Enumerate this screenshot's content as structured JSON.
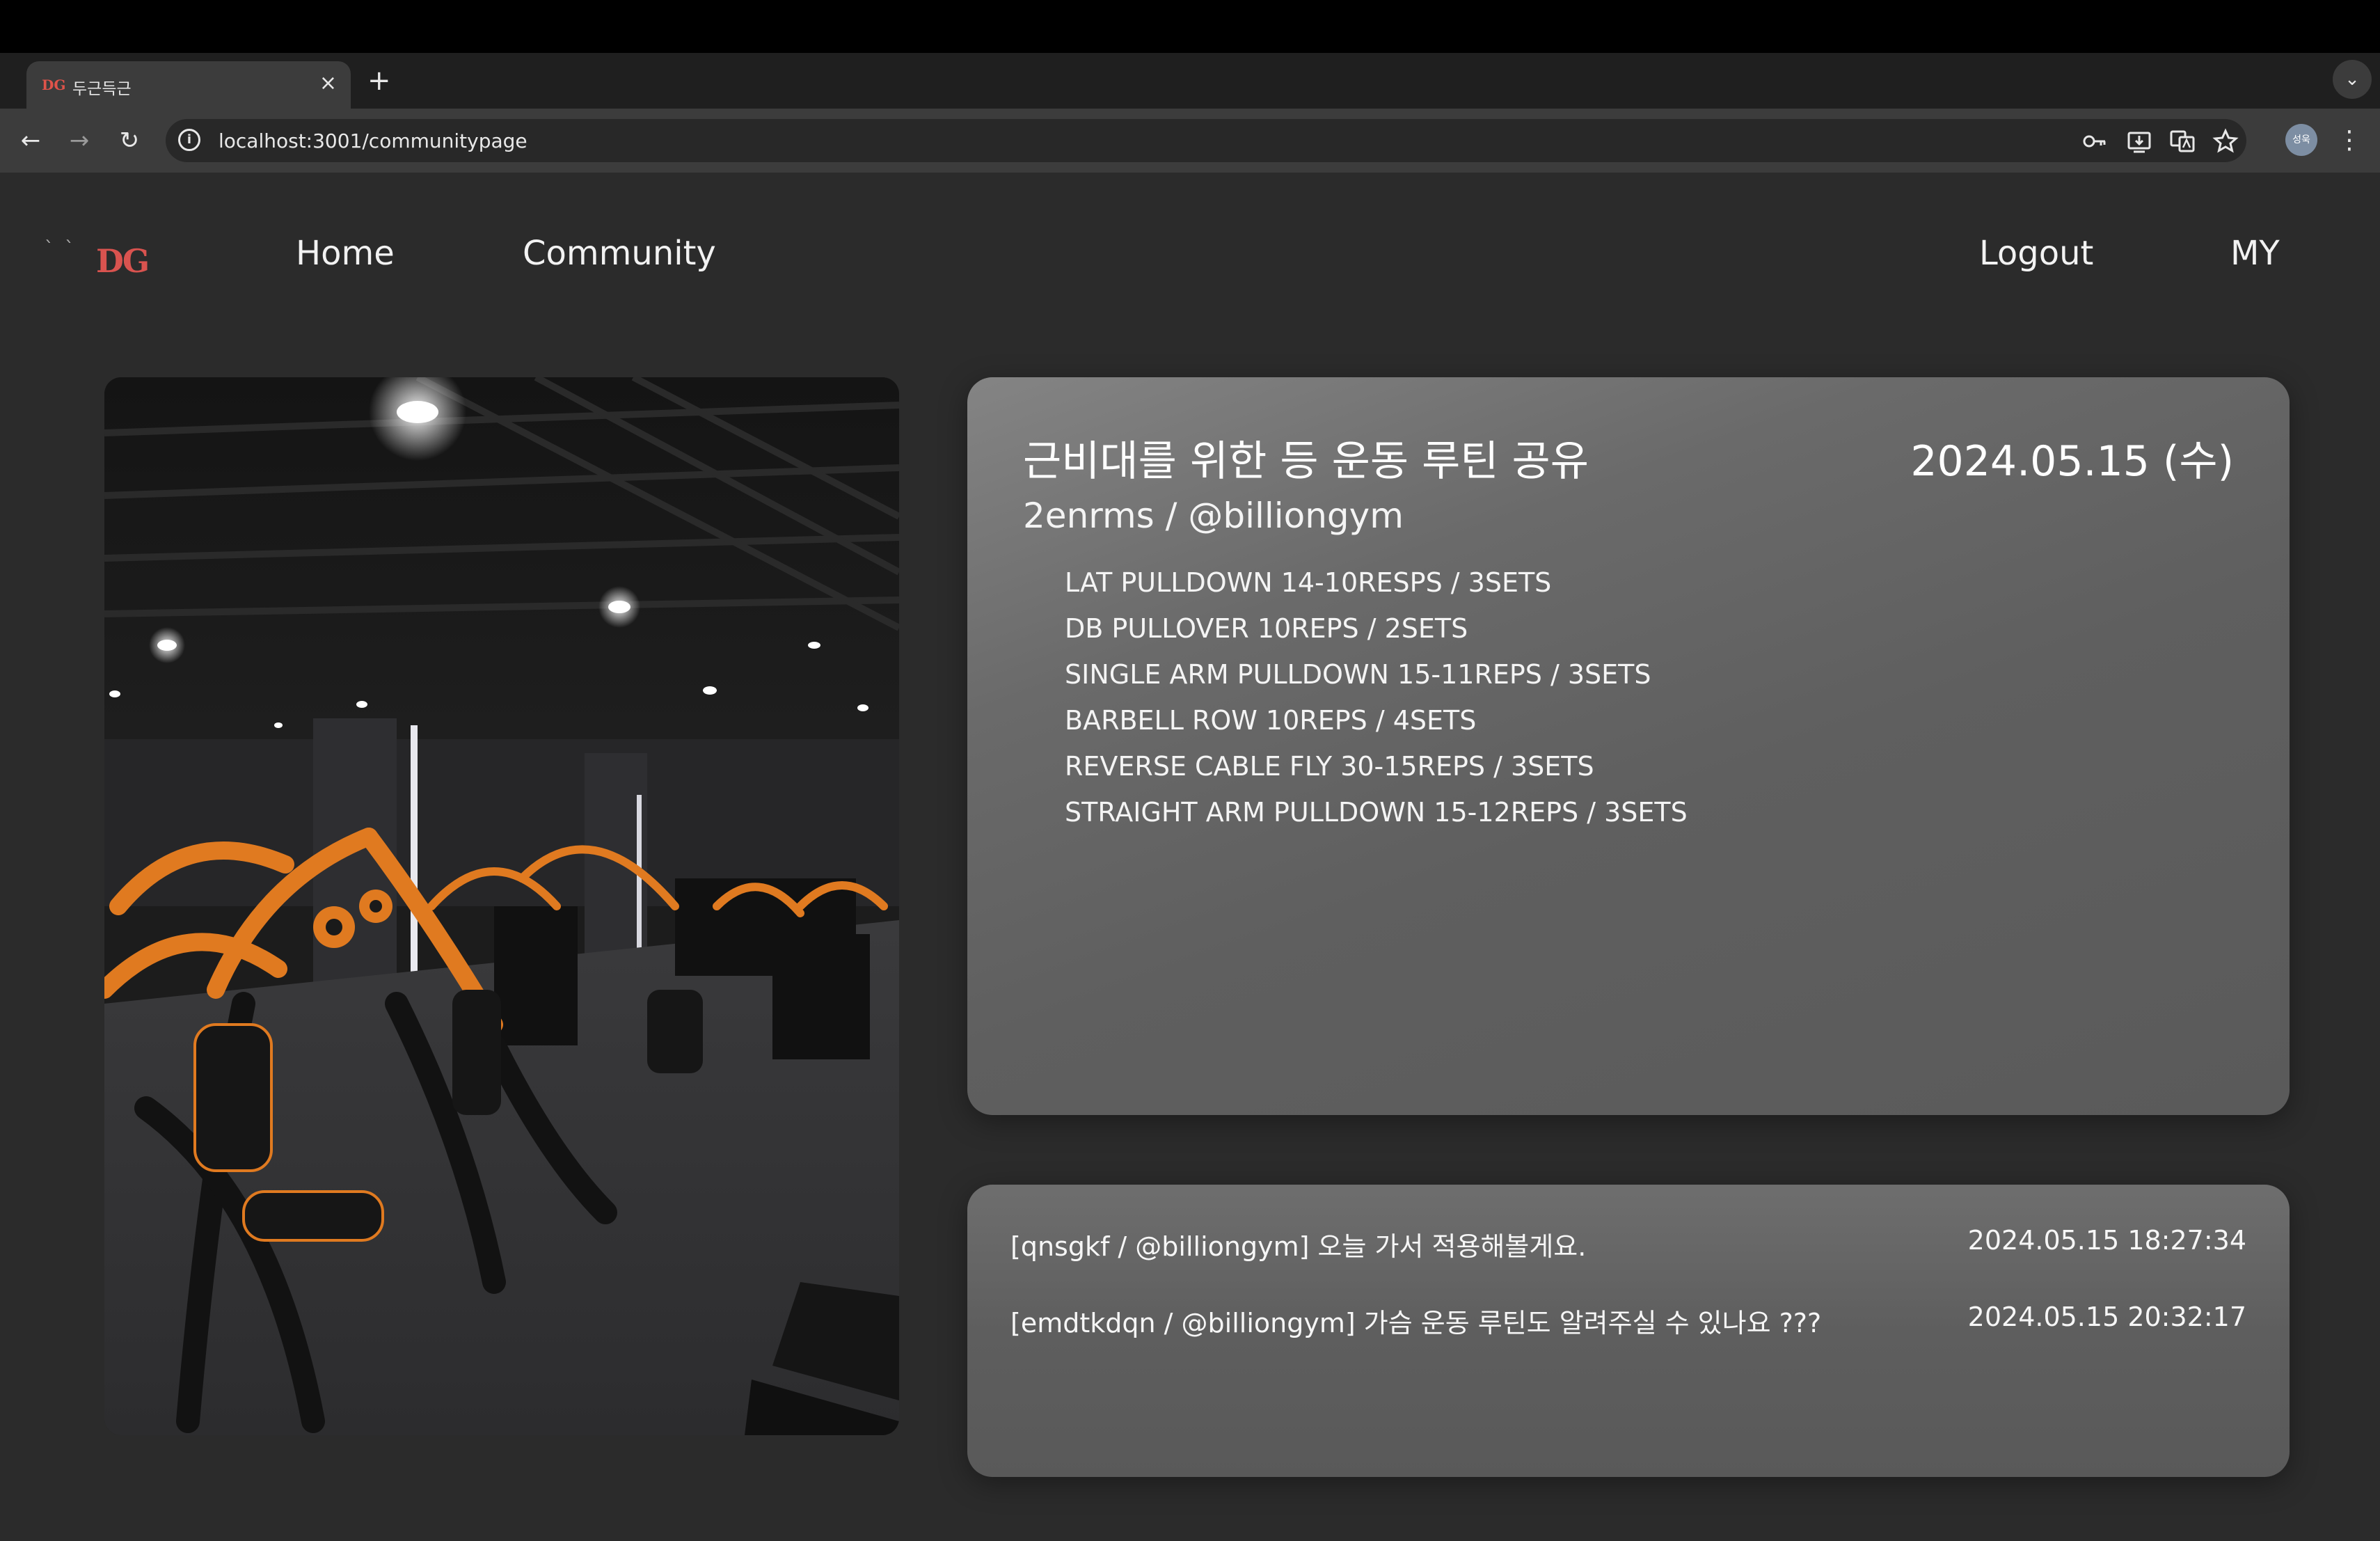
{
  "browser": {
    "tab": {
      "favicon": "DG",
      "title": "두근득근",
      "close": "×"
    },
    "new_tab": "+",
    "tab_menu": "⌄",
    "back": "←",
    "forward": "→",
    "reload": "↻",
    "site_info": "i",
    "url": "localhost:3001/communitypage",
    "icons": [
      "key-icon",
      "install-icon",
      "translate-icon",
      "star-icon"
    ],
    "profile": "성욱",
    "menu": "⋮"
  },
  "nav": {
    "logo": "DG",
    "dots": "` `",
    "home": "Home",
    "community": "Community",
    "logout": "Logout",
    "my": "MY"
  },
  "post": {
    "title": "근비대를 위한 등 운동 루틴 공유",
    "date": "2024.05.15 (수)",
    "author": "2enrms / @billiongym",
    "routine": [
      "LAT PULLDOWN 14-10RESPS / 3SETS",
      "DB PULLOVER 10REPS / 2SETS",
      "SINGLE ARM PULLDOWN 15-11REPS / 3SETS",
      "BARBELL ROW 10REPS / 4SETS",
      "REVERSE CABLE FLY 30-15REPS / 3SETS",
      "STRAIGHT ARM PULLDOWN 15-12REPS / 3SETS"
    ]
  },
  "comments": [
    {
      "text": "[qnsgkf / @billiongym] 오늘 가서 적용해볼게요.",
      "time": "2024.05.15 18:27:34"
    },
    {
      "text": "[emdtkdqn / @billiongym] 가슴 운동 루틴도 알려주실 수 있나요 ???",
      "time": "2024.05.15 20:32:17"
    }
  ],
  "colors": {
    "logo": "#d9534f",
    "page_bg": "#2b2b2b",
    "card": "#6a6a6a",
    "machine_orange": "#e07a20"
  }
}
